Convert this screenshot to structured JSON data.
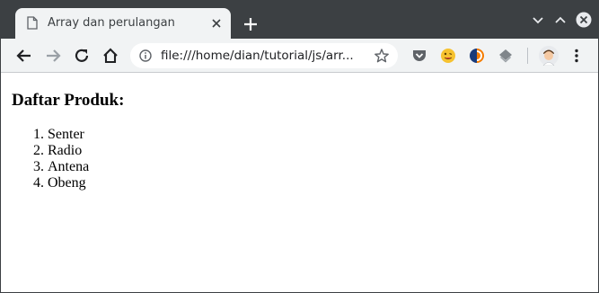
{
  "browser": {
    "tab": {
      "title": "Array dan perulangan",
      "favicon": "document-icon"
    },
    "new_tab_icon": "plus-icon",
    "window_controls": [
      "chevron-down-icon",
      "chevron-up-icon",
      "close-icon"
    ],
    "toolbar": {
      "back_icon": "arrow-left-icon",
      "forward_icon": "arrow-right-icon",
      "reload_icon": "reload-icon",
      "home_icon": "home-icon",
      "url": "file:///home/dian/tutorial/js/arr...",
      "bookmark_icon": "star-icon",
      "extensions": [
        "pocket-icon",
        "emoji-icon",
        "sync-icon",
        "layers-icon"
      ],
      "profile_icon": "avatar-icon",
      "menu_icon": "kebab-menu-icon"
    },
    "colors": {
      "frame": "#3c4043",
      "toolbar": "#f1f3f4",
      "tab": "#f1f3f4",
      "accent_red": "#db4437"
    }
  },
  "page": {
    "heading": "Daftar Produk:",
    "items": [
      {
        "number": "1.",
        "label": "Senter"
      },
      {
        "number": "2.",
        "label": "Radio"
      },
      {
        "number": "3.",
        "label": "Antena"
      },
      {
        "number": "4.",
        "label": "Obeng"
      }
    ]
  }
}
